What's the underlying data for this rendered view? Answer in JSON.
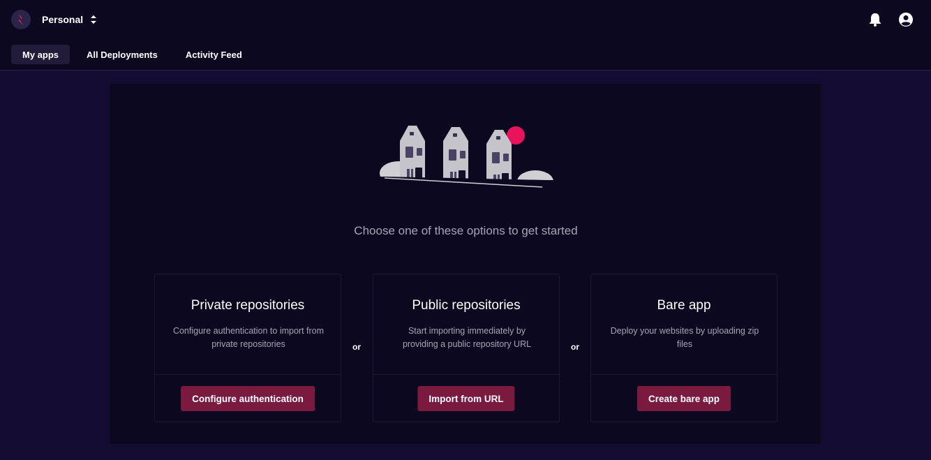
{
  "header": {
    "workspace": "Personal",
    "icons": [
      "lightning-logo-icon",
      "chevron-updown-icon",
      "bell-icon",
      "account-icon"
    ]
  },
  "tabs": [
    {
      "label": "My apps",
      "active": true
    },
    {
      "label": "All Deployments",
      "active": false
    },
    {
      "label": "Activity Feed",
      "active": false
    }
  ],
  "main": {
    "headline": "Choose one of these options to get started",
    "separator": "or",
    "cards": [
      {
        "title": "Private repositories",
        "description": "Configure authentication to import from private repositories",
        "button": "Configure authentication"
      },
      {
        "title": "Public repositories",
        "description": "Start importing immediately by providing a public repository URL",
        "button": "Import from URL"
      },
      {
        "title": "Bare app",
        "description": "Deploy your websites by uploading zip files",
        "button": "Create bare app"
      }
    ]
  },
  "colors": {
    "background": "#140c33",
    "surface": "#0c0820",
    "accent": "#7b1a3f",
    "brand": "#e8135a",
    "muted_text": "#a7a4b3"
  }
}
